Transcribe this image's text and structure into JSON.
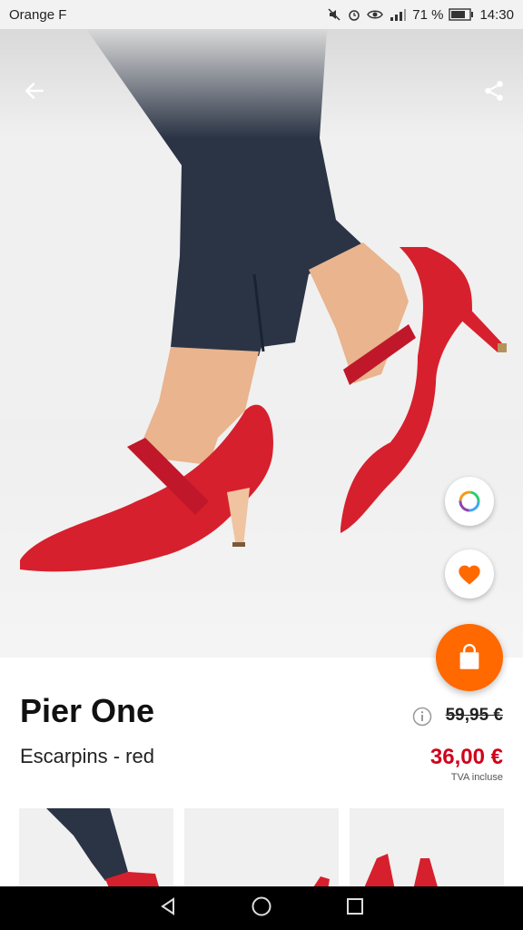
{
  "status_bar": {
    "carrier": "Orange F",
    "battery_percent": "71 %",
    "time": "14:30"
  },
  "product": {
    "brand": "Pier One",
    "name": "Escarpins - red",
    "old_price": "59,95 €",
    "price": "36,00 €",
    "tax_note": "TVA incluse"
  },
  "colors": {
    "accent": "#ff6900",
    "price_red": "#d0021b",
    "shoe_red": "#d7202d",
    "trouser_navy": "#2b3445"
  },
  "icons": {
    "back": "arrow-left-icon",
    "share": "share-icon",
    "color_picker": "color-ring-icon",
    "wishlist": "heart-icon",
    "cart": "shopping-bag-icon",
    "info": "info-icon"
  }
}
